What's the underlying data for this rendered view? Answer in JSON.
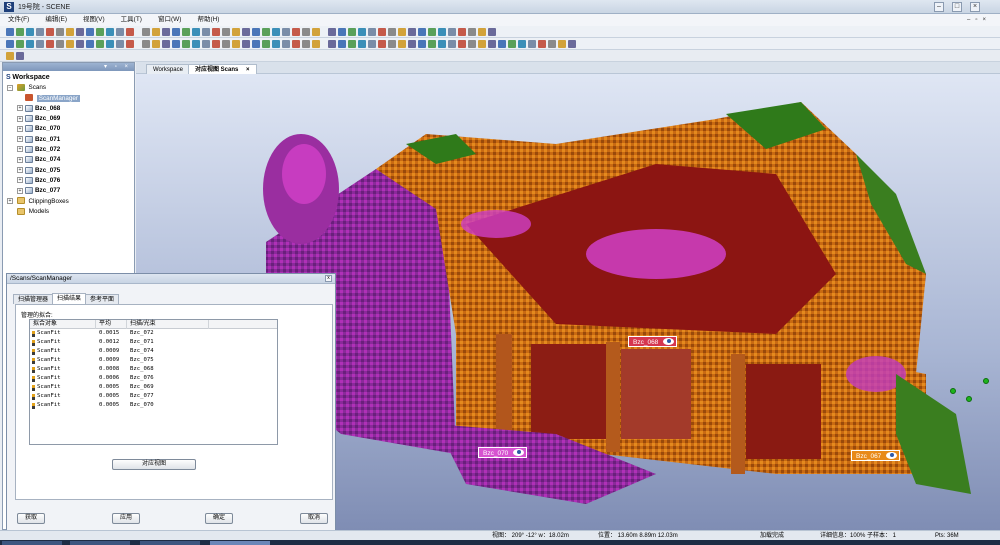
{
  "window": {
    "title": "19号院 - SCENE",
    "app_letter": "S"
  },
  "menu": [
    "文件(F)",
    "编辑(E)",
    "视图(V)",
    "工具(T)",
    "窗口(W)",
    "帮助(H)"
  ],
  "workspace_panel": {
    "title": "Workspace",
    "scans_label": "Scans",
    "scan_manager_label": "ScanManager",
    "scans": [
      "Bzc_068",
      "Bzc_069",
      "Bzc_070",
      "Bzc_071",
      "Bzc_072",
      "Bzc_074",
      "Bzc_075",
      "Bzc_076",
      "Bzc_077"
    ],
    "clipping_label": "ClippingBoxes",
    "models_label": "Models"
  },
  "tabs": [
    {
      "label": "Workspace"
    },
    {
      "label": "对应视图 Scans",
      "close": "×"
    }
  ],
  "viewport": {
    "scan_labels": [
      {
        "text": "Bzc_068",
        "color": "#d6364f"
      },
      {
        "text": "Bzc_070",
        "color": "#d653d0"
      },
      {
        "text": "Bzc_067",
        "color": "#e88a19"
      }
    ]
  },
  "dialog": {
    "title": "/Scans/ScanManager",
    "close": "x",
    "tabs": [
      "扫描管理器",
      "扫描结果",
      "参考平面"
    ],
    "active_tab": "扫描结果",
    "group_label": "管理的拟合:",
    "columns": [
      "拟合对象",
      "平均",
      "扫描/光束"
    ],
    "rows": [
      {
        "object": "ScanFit",
        "mean": "0.0015",
        "scan": "Bzc_072"
      },
      {
        "object": "ScanFit",
        "mean": "0.0012",
        "scan": "Bzc_071"
      },
      {
        "object": "ScanFit",
        "mean": "0.0009",
        "scan": "Bzc_074"
      },
      {
        "object": "ScanFit",
        "mean": "0.0009",
        "scan": "Bzc_075"
      },
      {
        "object": "ScanFit",
        "mean": "0.0008",
        "scan": "Bzc_068"
      },
      {
        "object": "ScanFit",
        "mean": "0.0006",
        "scan": "Bzc_076"
      },
      {
        "object": "ScanFit",
        "mean": "0.0005",
        "scan": "Bzc_069"
      },
      {
        "object": "ScanFit",
        "mean": "0.0005",
        "scan": "Bzc_077"
      },
      {
        "object": "ScanFit",
        "mean": "0.0005",
        "scan": "Bzc_070"
      }
    ],
    "corresponding_view_button": "对应视图",
    "buttons": {
      "get": "获取",
      "apply": "应用",
      "ok": "确定",
      "cancel": "取消"
    }
  },
  "status": {
    "view": "视图：  209° -12° w：18.02m",
    "position": "位置：  13.60m 8.89m 12.03m",
    "load": "加载完成",
    "detail": "详细信息：100%  子样本：  1",
    "fps": "Pts: 36M"
  }
}
